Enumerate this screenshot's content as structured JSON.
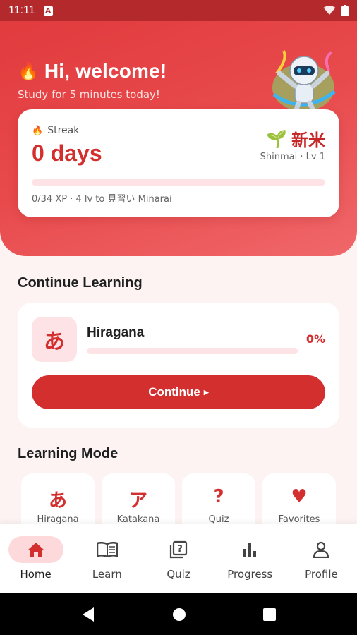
{
  "status_bar": {
    "time": "11:11"
  },
  "header": {
    "greeting": "Hi, welcome!",
    "subtitle": "Study for 5 minutes today!"
  },
  "streak": {
    "label": "Streak",
    "value": "0 days",
    "rank_kanji": "新米",
    "rank_sub": "Shinmai · Lv 1",
    "xp_progress": 0,
    "xp_text": "0/34 XP · 4 lv to 見習い Minarai"
  },
  "continue_section": {
    "title": "Continue Learning",
    "kana": "あ",
    "course_name": "Hiragana",
    "progress": 0,
    "progress_text": "0%",
    "button_label": "Continue"
  },
  "learning_mode": {
    "title": "Learning Mode",
    "modes": [
      {
        "glyph": "あ",
        "label": "Hiragana"
      },
      {
        "glyph": "ア",
        "label": "Katakana"
      },
      {
        "glyph": "?",
        "label": "Quiz"
      },
      {
        "glyph": "♥",
        "label": "Favorites"
      }
    ]
  },
  "bottom_nav": {
    "items": [
      {
        "label": "Home",
        "icon": "home-icon",
        "active": true
      },
      {
        "label": "Learn",
        "icon": "book-icon",
        "active": false
      },
      {
        "label": "Quiz",
        "icon": "quiz-icon",
        "active": false
      },
      {
        "label": "Progress",
        "icon": "bar-chart-icon",
        "active": false
      },
      {
        "label": "Profile",
        "icon": "person-icon",
        "active": false
      }
    ]
  },
  "colors": {
    "primary": "#d32f2f",
    "hero": "#e84a4c",
    "track": "#fde3e6",
    "active_pill": "#fdd9dc"
  }
}
